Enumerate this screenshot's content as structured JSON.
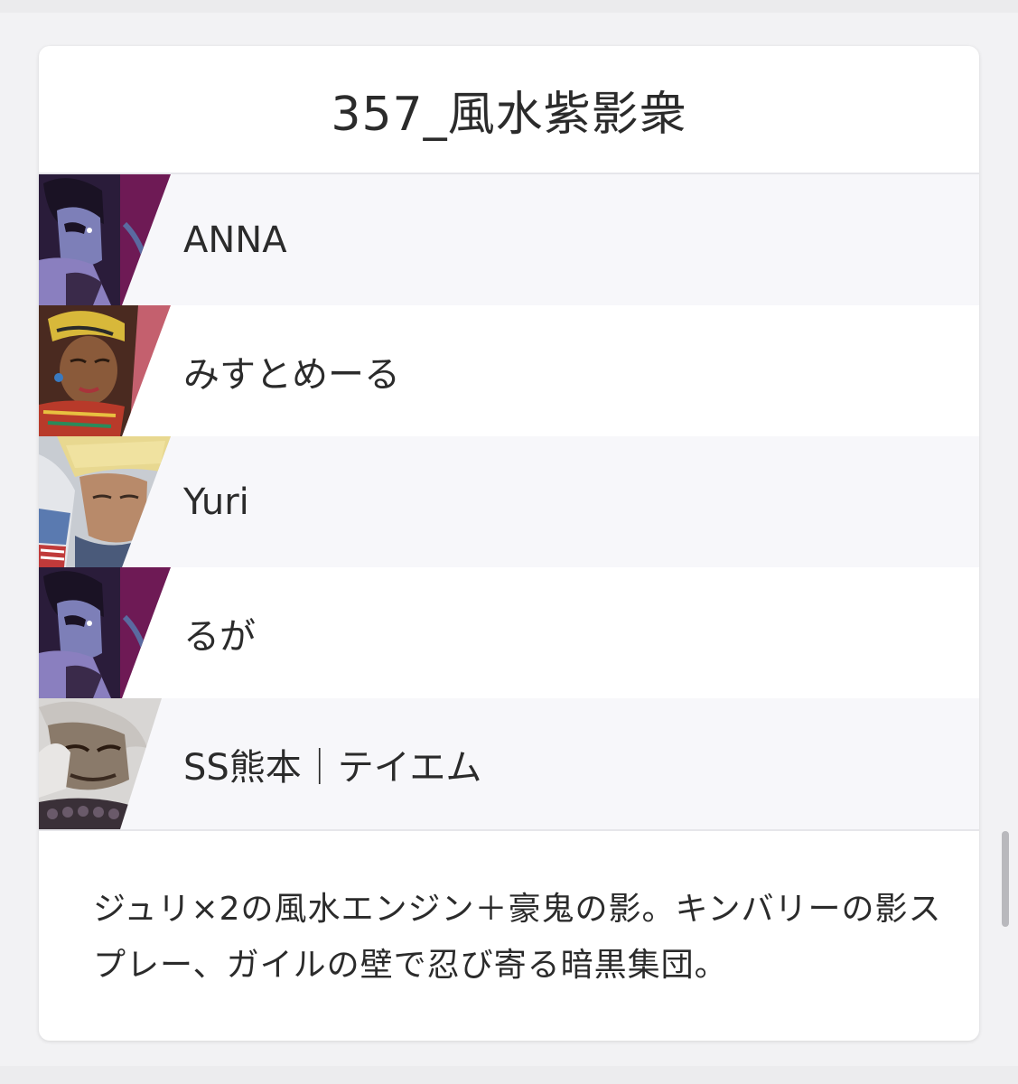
{
  "team": {
    "title": "357_風水紫影衆"
  },
  "members": [
    {
      "name": "ANNA",
      "avatar_icon": "juri-portrait-icon",
      "accent": "#7a1f5c"
    },
    {
      "name": "みすとめーる",
      "avatar_icon": "kimberly-portrait-icon",
      "accent": "#c75b6b"
    },
    {
      "name": "Yuri",
      "avatar_icon": "guile-portrait-icon",
      "accent": "#8fa2b8"
    },
    {
      "name": "るが",
      "avatar_icon": "juri-portrait-icon",
      "accent": "#7a1f5c"
    },
    {
      "name": "SS熊本｜テイエム",
      "avatar_icon": "akuma-portrait-icon",
      "accent": "#9a9a9a"
    }
  ],
  "description": "ジュリ×2の風水エンジン＋豪鬼の影。キンバリーの影スプレー、ガイルの壁で忍び寄る暗黒集団。"
}
